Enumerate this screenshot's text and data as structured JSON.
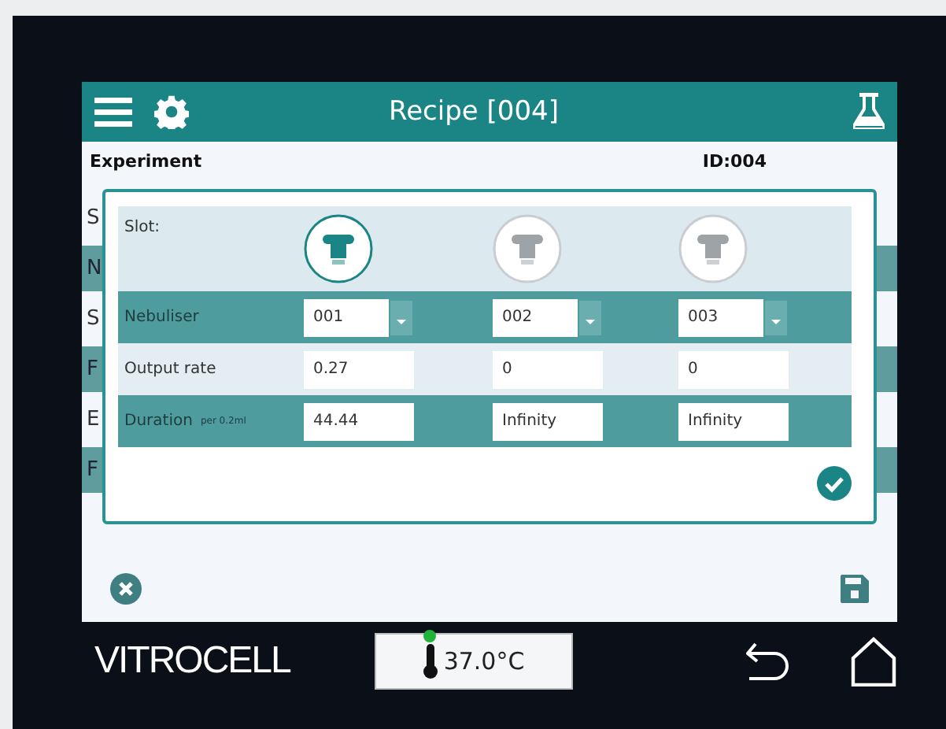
{
  "header": {
    "title": "Recipe [004]"
  },
  "experiment": {
    "label": "Experiment",
    "id": "ID:004"
  },
  "background_rows": [
    {
      "label": "S",
      "kind": "plain"
    },
    {
      "label": "N",
      "kind": "band"
    },
    {
      "label": "S",
      "kind": "plain"
    },
    {
      "label": "F",
      "kind": "band"
    },
    {
      "label": "E",
      "kind": "plain"
    },
    {
      "label": "F",
      "kind": "band"
    }
  ],
  "dialog": {
    "slot_label": "Slot:",
    "slots": [
      {
        "selected": true
      },
      {
        "selected": false
      },
      {
        "selected": false
      }
    ],
    "nebuliser_label": "Nebuliser",
    "nebulisers": [
      "001",
      "002",
      "003"
    ],
    "output_rate_label": "Output rate",
    "output_rates": [
      "0.27",
      "0",
      "0"
    ],
    "duration_label": "Duration",
    "duration_unit": "per 0.2ml",
    "durations": [
      "44.44",
      "Infinity",
      "Infinity"
    ]
  },
  "footer": {
    "logo": "VITROCELL",
    "temperature": "37.0°C"
  }
}
